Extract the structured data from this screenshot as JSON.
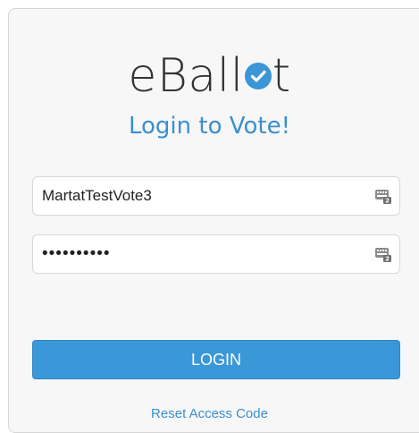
{
  "brand": {
    "logo_text_before": "eBall",
    "logo_text_after": "t",
    "logo_icon": "check-circle-icon",
    "accent_color": "#3b95d6"
  },
  "heading": {
    "subtitle": "Login to Vote!"
  },
  "form": {
    "username": {
      "value": "MartatTestVote3",
      "icon": "keyboard-icon"
    },
    "password": {
      "value": "••••••••••",
      "icon": "keyboard-icon"
    },
    "login_label": "LOGIN",
    "login_color": "#3a97d8",
    "reset_label": "Reset Access Code"
  }
}
